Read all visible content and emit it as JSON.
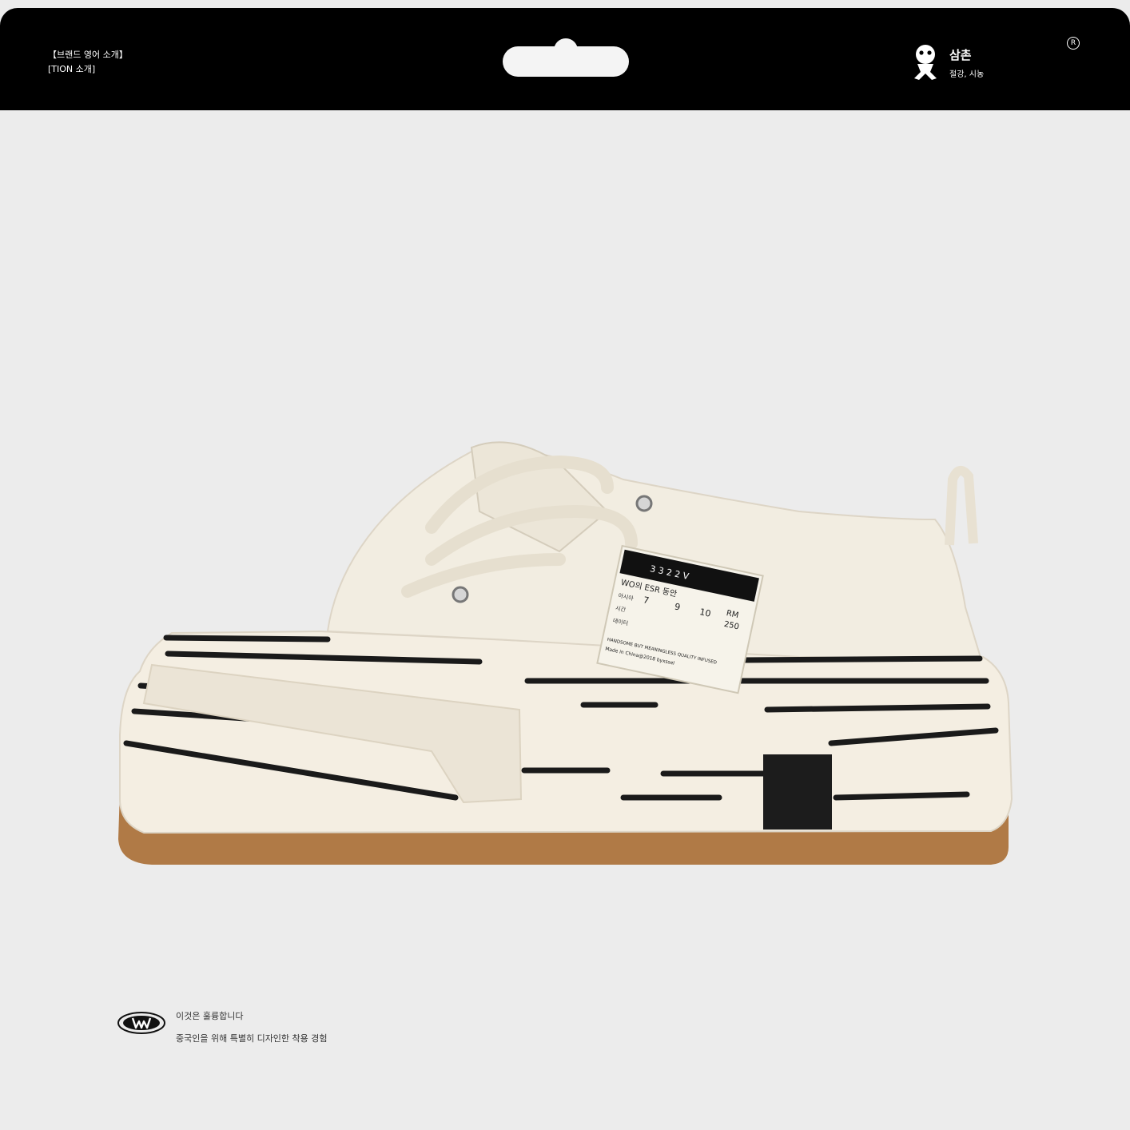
{
  "header": {
    "brand_intro_line1": "【브랜드 영어 소개】",
    "brand_intro_line2": "[TION 소개]",
    "right_brand_name": "삼촌",
    "right_brand_tagline": "절강, 시농",
    "registered_mark": "R"
  },
  "product_tag": {
    "code": "3 3 2 2 V",
    "line1": "WO의 ESR 동안",
    "row_label1": "아시아",
    "row_label2": "시간",
    "row_label3": "데이터",
    "sizes": [
      "7",
      "9",
      "10"
    ],
    "rm_label": "RM",
    "rm_value": "250",
    "footer1": "HANDSOME BUT MEANINGLESS QUALITY INFUSED",
    "footer2": "Made in China@2018 byxssel"
  },
  "footer": {
    "line1": "이것은 훌륭합니다",
    "line2": "중국인을 위해 특별히 디자인한 착용 경험"
  },
  "colors": {
    "header_bg": "#000000",
    "page_bg": "#ececec",
    "canvas": "#f3eee2",
    "sole_rubber": "#b07a46",
    "stripe": "#1a1a1a"
  }
}
